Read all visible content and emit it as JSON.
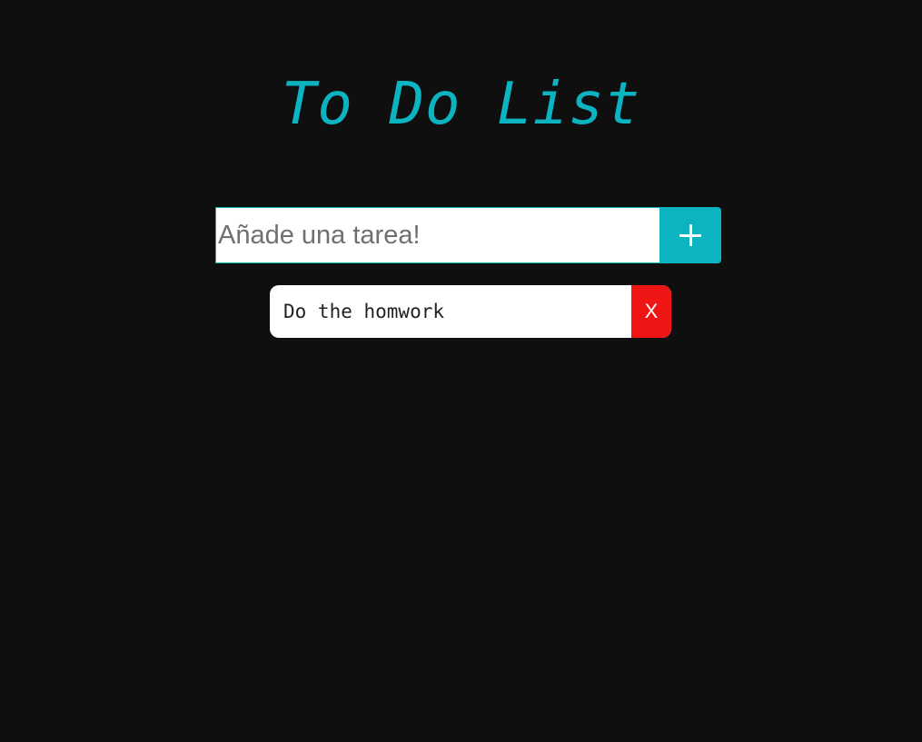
{
  "header": {
    "title": "To Do List"
  },
  "new_task": {
    "value": "",
    "placeholder": "Añade una tarea!",
    "add_icon": "plus-icon"
  },
  "tasks": [
    {
      "text": "Do the homwork",
      "delete_label": "X"
    }
  ],
  "colors": {
    "background": "#0f0f10",
    "accent": "#0cb3c1",
    "delete": "#ef1515",
    "surface": "#ffffff"
  }
}
